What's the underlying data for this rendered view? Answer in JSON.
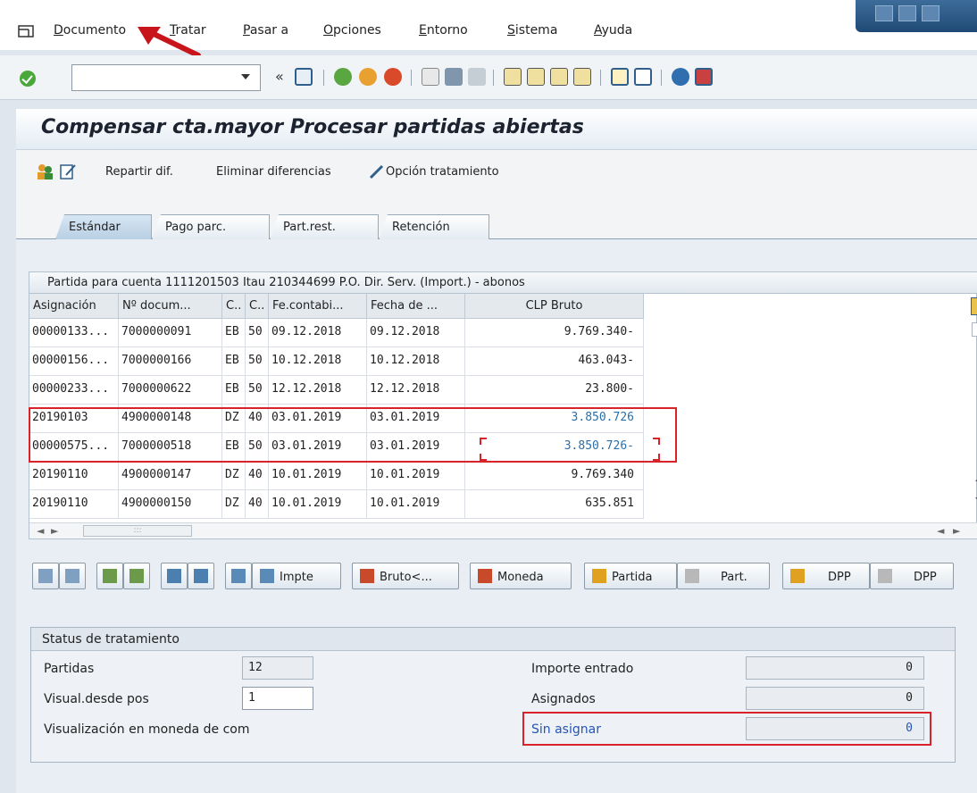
{
  "menu": {
    "items": [
      {
        "label": "Documento",
        "key": "D",
        "rest": "ocumento"
      },
      {
        "label": "Tratar",
        "key": "T",
        "rest": "ratar"
      },
      {
        "label": "Pasar a",
        "key": "P",
        "rest": "asar a"
      },
      {
        "label": "Opciones",
        "key": "O",
        "rest": "pciones"
      },
      {
        "label": "Entorno",
        "key": "E",
        "rest": "ntorno"
      },
      {
        "label": "Sistema",
        "key": "S",
        "rest": "istema"
      },
      {
        "label": "Ayuda",
        "key": "A",
        "rest": "yuda"
      }
    ]
  },
  "toolbar": {
    "command_value": "",
    "back_symbol": "«"
  },
  "title": "Compensar cta.mayor Procesar partidas abiertas",
  "appbar": {
    "repartir": "Repartir dif.",
    "eliminar": "Eliminar diferencias",
    "opcion": "Opción tratamiento"
  },
  "tabs": [
    "Estándar",
    "Pago parc.",
    "Part.rest.",
    "Retención"
  ],
  "table": {
    "caption": "Partida para cuenta 1111201503 Itau 210344699 P.O. Dir. Serv. (Import.) - abonos",
    "headers": [
      "Asignación",
      "Nº docum...",
      "C..",
      "C..",
      "Fe.contabi...",
      "Fecha de ...",
      "CLP Bruto"
    ],
    "rows": [
      [
        "00000133...",
        "7000000091",
        "EB",
        "50",
        "09.12.2018",
        "09.12.2018",
        "9.769.340-"
      ],
      [
        "00000156...",
        "7000000166",
        "EB",
        "50",
        "10.12.2018",
        "10.12.2018",
        "463.043-"
      ],
      [
        "00000233...",
        "7000000622",
        "EB",
        "50",
        "12.12.2018",
        "12.12.2018",
        "23.800-"
      ],
      [
        "20190103",
        "4900000148",
        "DZ",
        "40",
        "03.01.2019",
        "03.01.2019",
        "3.850.726"
      ],
      [
        "00000575...",
        "7000000518",
        "EB",
        "50",
        "03.01.2019",
        "03.01.2019",
        "3.850.726-"
      ],
      [
        "20190110",
        "4900000147",
        "DZ",
        "40",
        "10.01.2019",
        "10.01.2019",
        "9.769.340"
      ],
      [
        "20190110",
        "4900000150",
        "DZ",
        "40",
        "10.01.2019",
        "10.01.2019",
        "635.851"
      ]
    ],
    "hscroll_dots": ":::"
  },
  "buttons": {
    "impte": "Impte",
    "bruto": "Bruto<...",
    "moneda": "Moneda",
    "partida": "Partida",
    "part": "Part.",
    "dpp1": "DPP",
    "dpp2": "DPP"
  },
  "status": {
    "title": "Status de tratamiento",
    "partidas_label": "Partidas",
    "partidas_value": "12",
    "visual_label": "Visual.desde pos",
    "visual_value": "1",
    "moneda_label": "Visualización en moneda de com",
    "importe_label": "Importe entrado",
    "importe_value": "0",
    "asignados_label": "Asignados",
    "asignados_value": "0",
    "sin_label": "Sin asignar",
    "sin_value": "0"
  },
  "colors": {
    "highlight": "#d9232a",
    "link_blue": "#2654b5",
    "ok_green": "#4aa83a"
  }
}
